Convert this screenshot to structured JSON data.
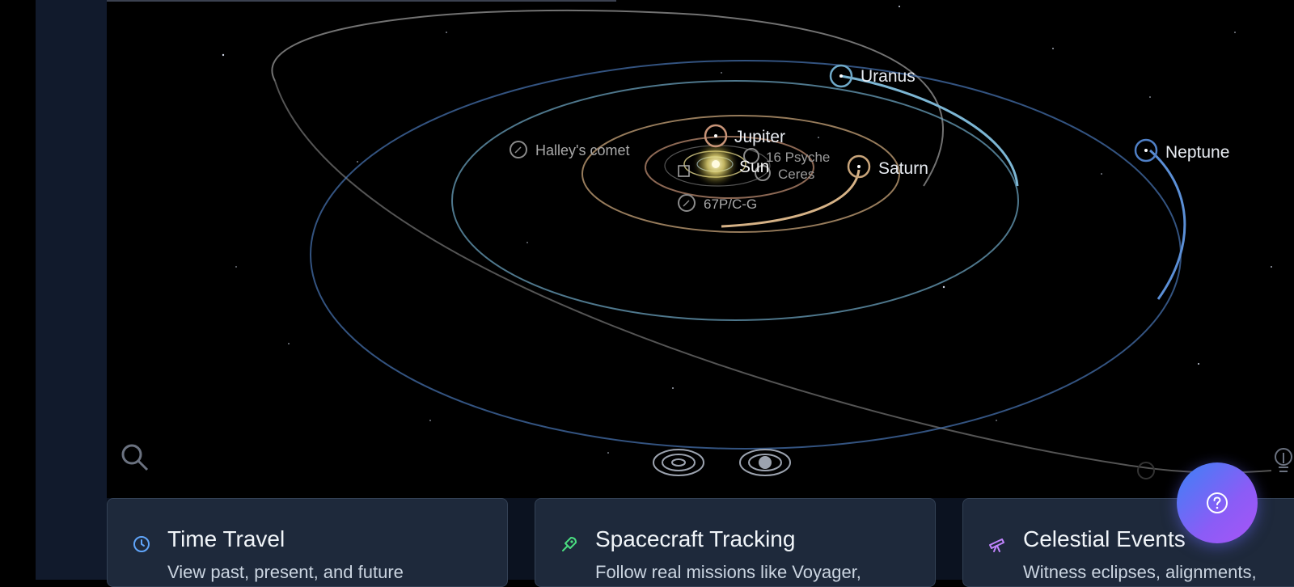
{
  "map": {
    "labels": {
      "uranus": "Uranus",
      "neptune": "Neptune",
      "jupiter": "Jupiter",
      "saturn": "Saturn",
      "sun": "Sun",
      "psyche": "16 Psyche",
      "ceres": "Ceres",
      "halley": "Halley's comet",
      "comet67p": "67P/C-G"
    }
  },
  "cards": [
    {
      "title": "Time Travel",
      "description": "View past, present, and future",
      "icon": "clock-icon",
      "color": "#60a5fa"
    },
    {
      "title": "Spacecraft Tracking",
      "description": "Follow real missions like Voyager,",
      "icon": "rocket-icon",
      "color": "#4ade80"
    },
    {
      "title": "Celestial Events",
      "description": "Witness eclipses, alignments,",
      "icon": "telescope-icon",
      "color": "#c084fc"
    }
  ],
  "colors": {
    "uranus": "#6fa9c8",
    "neptune": "#4f7fc5",
    "saturn": "#c8a47a",
    "jupiter": "#c89478",
    "halley": "#9a9a9a",
    "accent_gradient": [
      "#3b82f6",
      "#a855f7"
    ]
  }
}
